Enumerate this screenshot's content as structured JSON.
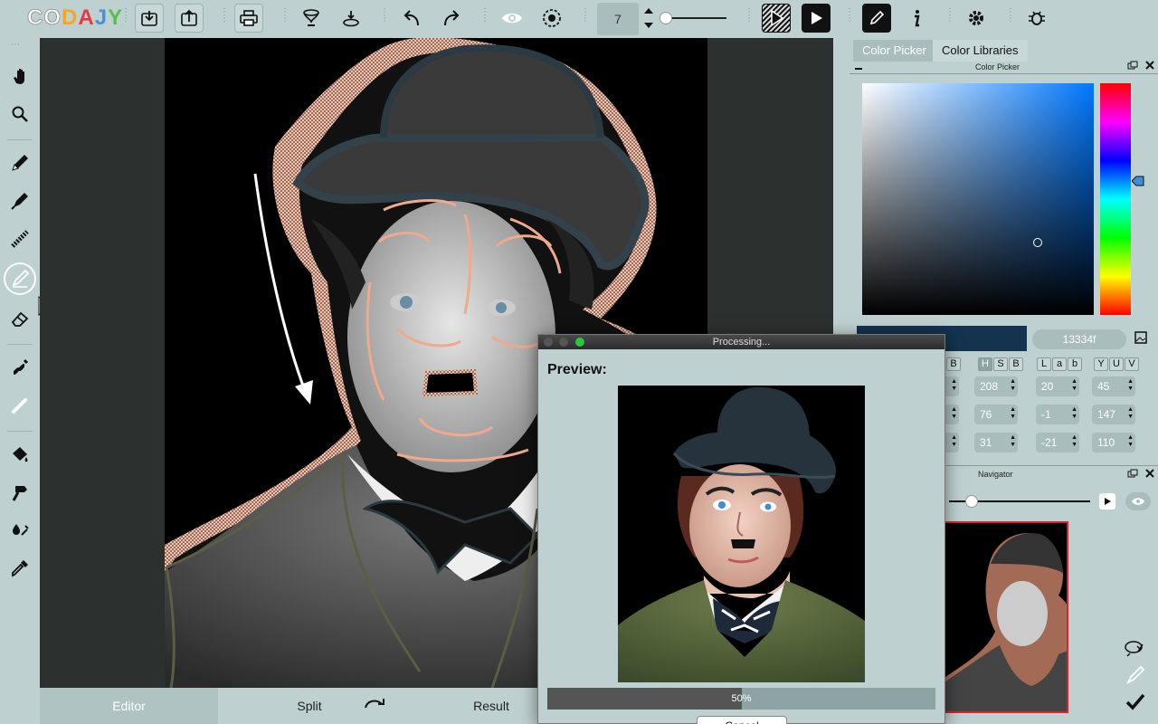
{
  "app": {
    "logo": [
      "C",
      "O",
      "D",
      "A",
      "J",
      "Y"
    ],
    "logo_colors": [
      "#ffffff",
      "#ffffff",
      "#f6a623",
      "#e63946",
      "#4a90e2",
      "#58c04a"
    ]
  },
  "toolbar": {
    "icons": [
      "download-icon",
      "upload-icon",
      "print-icon",
      "funnel-icon",
      "spray-icon",
      "undo-icon",
      "redo-icon",
      "eye-icon",
      "film-icon",
      "hatch-play-icon",
      "play-icon",
      "pen-icon",
      "info-icon",
      "settings-icon",
      "bug-icon"
    ],
    "brush_size": "7"
  },
  "tools": [
    "hand-icon",
    "zoom-icon",
    "pencil-icon",
    "marker-icon",
    "dotted-brush-icon",
    "color-brush-icon",
    "eraser-icon",
    "smudge-icon",
    "chalk-icon",
    "bucket-icon",
    "hammer-icon",
    "dropper-plus-icon",
    "eyedropper-icon"
  ],
  "bottom_tabs": {
    "editor": "Editor",
    "split": "Split",
    "result": "Result"
  },
  "right_panel": {
    "tab_picker": "Color Picker",
    "tab_libraries": "Color Libraries",
    "picker_header": "Color Picker",
    "hex": "13334f",
    "swatch_color": "#13334f",
    "hsb_header": [
      "H",
      "S",
      "B"
    ],
    "lab_header": [
      "L",
      "a",
      "b"
    ],
    "yuv_header": [
      "Y",
      "U",
      "V"
    ],
    "hsb": [
      "208",
      "76",
      "31"
    ],
    "lab": [
      "20",
      "-1",
      "-21"
    ],
    "yuv": [
      "45",
      "147",
      "110"
    ],
    "navigator_header": "Navigator"
  },
  "dialog": {
    "title": "Processing...",
    "preview_label": "Preview:",
    "progress_text": "50%",
    "progress": 0.5,
    "cancel": "Cancel"
  }
}
